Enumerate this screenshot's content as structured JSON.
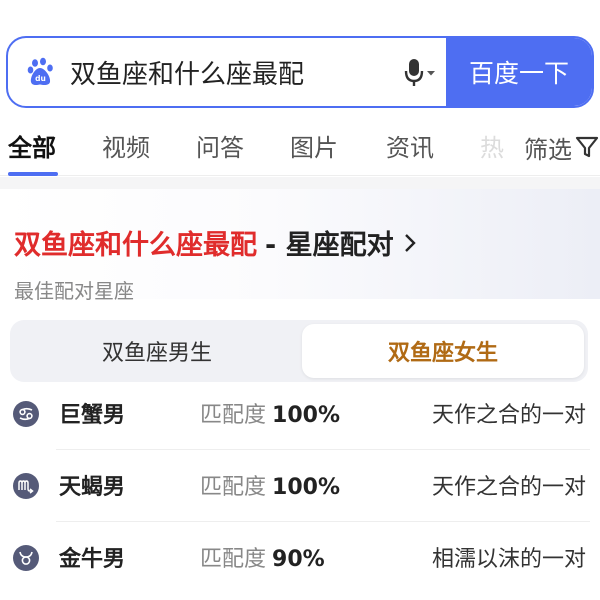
{
  "search": {
    "query": "双鱼座和什么座最配",
    "submit_label": "百度一下"
  },
  "tabs": [
    {
      "label": "全部"
    },
    {
      "label": "视频"
    },
    {
      "label": "问答"
    },
    {
      "label": "图片"
    },
    {
      "label": "资讯"
    },
    {
      "label": "热"
    }
  ],
  "filter_label": "筛选",
  "card": {
    "title_query": "双鱼座和什么座最配",
    "title_rest": "- 星座配对",
    "subtitle": "最佳配对星座",
    "toggle": {
      "male_label": "双鱼座男生",
      "female_label": "双鱼座女生",
      "selected": "female"
    },
    "matches": [
      {
        "icon": "cancer-icon",
        "sign": "巨蟹男",
        "degree_label": "匹配度",
        "degree": "100%",
        "desc": "天作之合的一对"
      },
      {
        "icon": "scorpio-icon",
        "sign": "天蝎男",
        "degree_label": "匹配度",
        "degree": "100%",
        "desc": "天作之合的一对"
      },
      {
        "icon": "taurus-icon",
        "sign": "金牛男",
        "degree_label": "匹配度",
        "degree": "90%",
        "desc": "相濡以沫的一对"
      }
    ]
  },
  "colors": {
    "accent": "#4e6ef2",
    "query_red": "#e02c2c",
    "selected_gold": "#b06a14",
    "zodiac_badge": "#555a78"
  }
}
